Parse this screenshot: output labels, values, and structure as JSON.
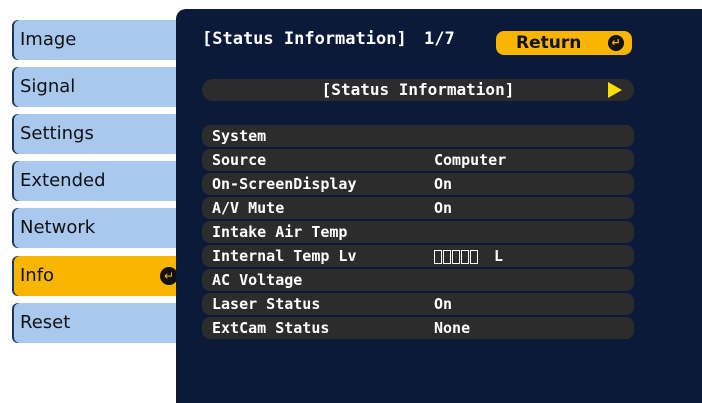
{
  "menu": {
    "items": [
      {
        "label": "Image",
        "active": false
      },
      {
        "label": "Signal",
        "active": false
      },
      {
        "label": "Settings",
        "active": false
      },
      {
        "label": "Extended",
        "active": false
      },
      {
        "label": "Network",
        "active": false
      },
      {
        "label": "Info",
        "active": true
      },
      {
        "label": "Reset",
        "active": false
      }
    ]
  },
  "panel": {
    "header_title": "[Status Information]",
    "page_indicator": "1/7",
    "return_label": "Return",
    "section_title": "[Status Information]",
    "rows": [
      {
        "label": "System",
        "value": ""
      },
      {
        "label": "Source",
        "value": "Computer"
      },
      {
        "label": "On-ScreenDisplay",
        "value": "On"
      },
      {
        "label": "A/V Mute",
        "value": "On"
      },
      {
        "label": "Intake Air Temp",
        "value": ""
      },
      {
        "label": "Internal Temp Lv",
        "value": "L",
        "level_boxes": 5
      },
      {
        "label": "AC Voltage",
        "value": ""
      },
      {
        "label": "Laser Status",
        "value": "On"
      },
      {
        "label": "ExtCam Status",
        "value": "None"
      }
    ]
  },
  "colors": {
    "panel_bg": "#0b1a38",
    "tab_bg": "#a8c8ee",
    "tab_active": "#f7b500",
    "row_bg": "#2c2c2c",
    "arrow": "#f7e100"
  },
  "icons": {
    "enter": "enter-icon",
    "next_page": "right-arrow-icon"
  }
}
